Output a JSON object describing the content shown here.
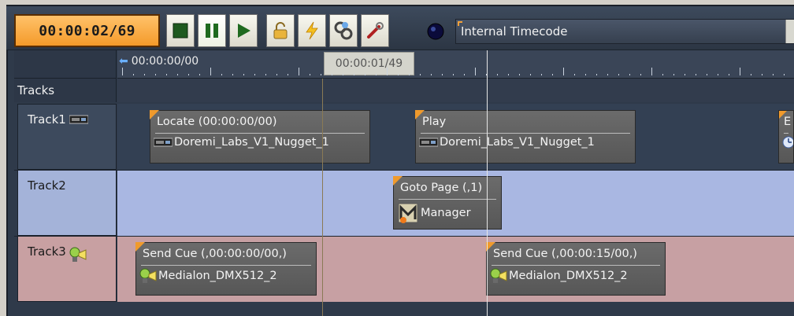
{
  "toolbar": {
    "timecode": "00:00:02/69",
    "buttons": [
      {
        "name": "stop-button",
        "icon": "stop-icon"
      },
      {
        "name": "pause-button",
        "icon": "pause-icon"
      },
      {
        "name": "play-button",
        "icon": "play-icon"
      },
      {
        "name": "lock-button",
        "icon": "lock-icon"
      },
      {
        "name": "flash-button",
        "icon": "lightning-icon"
      },
      {
        "name": "devices-button",
        "icon": "chain-icon"
      },
      {
        "name": "tools-button",
        "icon": "wrench-icon"
      }
    ],
    "timecode_source": "Internal Timecode"
  },
  "ruler": {
    "start_time": "00:00:00/00",
    "cursor_time": "00:00:01/49"
  },
  "tracks_header": "Tracks",
  "tracks": [
    {
      "name": "Track1",
      "color": "#334053",
      "cues": [
        {
          "title": "Locate (00:00:00/00)",
          "device": "Doremi_Labs_V1_Nugget_1"
        },
        {
          "title": "Play",
          "device": "Doremi_Labs_V1_Nugget_1"
        },
        {
          "title": "E",
          "device": ""
        }
      ]
    },
    {
      "name": "Track2",
      "color": "#a9b7e2",
      "cues": [
        {
          "title": "Goto Page (,1)",
          "device": "Manager"
        }
      ]
    },
    {
      "name": "Track3",
      "color": "#c7a0a3",
      "cues": [
        {
          "title": "Send Cue (,00:00:00/00,)",
          "device": "Medialon_DMX512_2"
        },
        {
          "title": "Send Cue (,00:00:15/00,)",
          "device": "Medialon_DMX512_2"
        }
      ]
    }
  ],
  "colors": {
    "timecode_bg": "#f49a2a",
    "cue_corner": "#f09a2c",
    "panel": "#2f3a4a"
  }
}
